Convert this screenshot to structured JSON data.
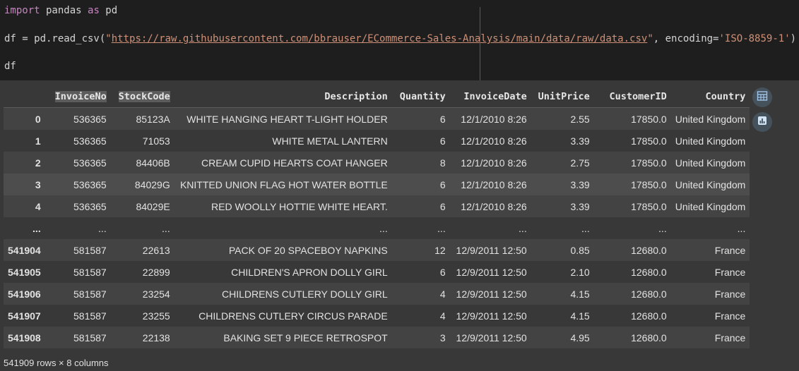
{
  "code": {
    "import_kw": "import",
    "import_mod": " pandas ",
    "as_kw": "as",
    "alias": " pd",
    "line2_prefix": "df = pd.read_csv(",
    "line2_quote_open": "\"",
    "line2_url": "https://raw.githubusercontent.com/bbrauser/ECommerce-Sales-Analysis/main/data/raw/data.csv",
    "line2_quote_close": "\"",
    "line2_mid": ", encoding=",
    "line2_enc": "'ISO-8859-1'",
    "line2_end": ")",
    "line3": "df"
  },
  "table": {
    "columns": [
      "",
      "InvoiceNo",
      "StockCode",
      "Description",
      "Quantity",
      "InvoiceDate",
      "UnitPrice",
      "CustomerID",
      "Country"
    ],
    "rows": [
      [
        "0",
        "536365",
        "85123A",
        "WHITE HANGING HEART T-LIGHT HOLDER",
        "6",
        "12/1/2010 8:26",
        "2.55",
        "17850.0",
        "United Kingdom"
      ],
      [
        "1",
        "536365",
        "71053",
        "WHITE METAL LANTERN",
        "6",
        "12/1/2010 8:26",
        "3.39",
        "17850.0",
        "United Kingdom"
      ],
      [
        "2",
        "536365",
        "84406B",
        "CREAM CUPID HEARTS COAT HANGER",
        "8",
        "12/1/2010 8:26",
        "2.75",
        "17850.0",
        "United Kingdom"
      ],
      [
        "3",
        "536365",
        "84029G",
        "KNITTED UNION FLAG HOT WATER BOTTLE",
        "6",
        "12/1/2010 8:26",
        "3.39",
        "17850.0",
        "United Kingdom"
      ],
      [
        "4",
        "536365",
        "84029E",
        "RED WOOLLY HOTTIE WHITE HEART.",
        "6",
        "12/1/2010 8:26",
        "3.39",
        "17850.0",
        "United Kingdom"
      ],
      [
        "...",
        "...",
        "...",
        "...",
        "...",
        "...",
        "...",
        "...",
        "..."
      ],
      [
        "541904",
        "581587",
        "22613",
        "PACK OF 20 SPACEBOY NAPKINS",
        "12",
        "12/9/2011 12:50",
        "0.85",
        "12680.0",
        "France"
      ],
      [
        "541905",
        "581587",
        "22899",
        "CHILDREN'S APRON DOLLY GIRL",
        "6",
        "12/9/2011 12:50",
        "2.10",
        "12680.0",
        "France"
      ],
      [
        "541906",
        "581587",
        "23254",
        "CHILDRENS CUTLERY DOLLY GIRL",
        "4",
        "12/9/2011 12:50",
        "4.15",
        "12680.0",
        "France"
      ],
      [
        "541907",
        "581587",
        "23255",
        "CHILDRENS CUTLERY CIRCUS PARADE",
        "4",
        "12/9/2011 12:50",
        "4.15",
        "12680.0",
        "France"
      ],
      [
        "541908",
        "581587",
        "22138",
        "BAKING SET 9 PIECE RETROSPOT",
        "3",
        "12/9/2011 12:50",
        "4.95",
        "12680.0",
        "France"
      ]
    ],
    "hover_row": 3
  },
  "footer": "541909 rows × 8 columns",
  "side_buttons": [
    "table-icon",
    "chart-icon"
  ]
}
